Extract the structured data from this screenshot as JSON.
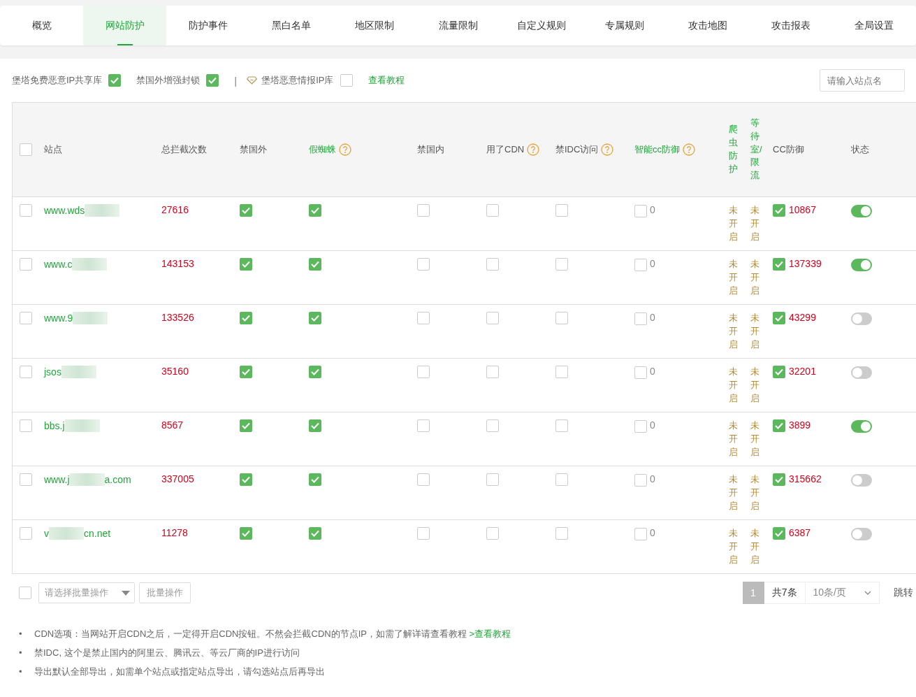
{
  "tabs": [
    {
      "label": "概览",
      "selected": false
    },
    {
      "label": "网站防护",
      "selected": true
    },
    {
      "label": "防护事件",
      "selected": false
    },
    {
      "label": "黑白名单",
      "selected": false
    },
    {
      "label": "地区限制",
      "selected": false
    },
    {
      "label": "流量限制",
      "selected": false
    },
    {
      "label": "自定义规则",
      "selected": false
    },
    {
      "label": "专属规则",
      "selected": false
    },
    {
      "label": "攻击地图",
      "selected": false
    },
    {
      "label": "攻击报表",
      "selected": false
    },
    {
      "label": "全局设置",
      "selected": false
    }
  ],
  "filters": [
    {
      "kind": "check",
      "label": "堡塔免费恶意IP共享库",
      "checked": true
    },
    {
      "kind": "check",
      "label": "禁国外增强封锁",
      "checked": true
    },
    {
      "kind": "separator",
      "label": "|"
    },
    {
      "kind": "premium",
      "label": "堡塔恶意情报IP库",
      "checked": false
    },
    {
      "kind": "link",
      "label": "查看教程"
    }
  ],
  "search": {
    "placeholder": "请输入站点名"
  },
  "table": {
    "header_checked": false,
    "columns": [
      {
        "label": "站点",
        "accent": false,
        "vertical": false
      },
      {
        "label": "总拦截次数",
        "accent": false,
        "vertical": false
      },
      {
        "label": "禁国外",
        "accent": false,
        "vertical": false
      },
      {
        "label": "假蜘蛛",
        "accent": true,
        "help": true,
        "vertical": false
      },
      {
        "label": "禁国内",
        "accent": false,
        "vertical": false
      },
      {
        "label": "用了CDN",
        "accent": false,
        "help": true,
        "vertical": false
      },
      {
        "label": "禁IDC访问",
        "accent": false,
        "help": true,
        "vertical": false
      },
      {
        "label": "智能cc防御",
        "accent": true,
        "help": true,
        "vertical": false
      },
      {
        "label": "爬虫防护",
        "accent": true,
        "vertical": true
      },
      {
        "label": "等待室/限流",
        "accent": true,
        "vertical": true
      },
      {
        "label": "CC防御",
        "accent": false,
        "vertical": false
      },
      {
        "label": "状态",
        "accent": false,
        "vertical": false
      }
    ],
    "rows": [
      {
        "selected": false,
        "site": "www.wds",
        "total": "27616",
        "ban_foreign": true,
        "fake_spider": true,
        "ban_domestic": false,
        "cdn": false,
        "idc": false,
        "smart_cc": false,
        "smart_cc_count": "0",
        "crawler": "未开启",
        "waiting_room": "未开启",
        "cc": true,
        "cc_count": "10867",
        "on": true
      },
      {
        "selected": false,
        "site": "www.c",
        "total": "143153",
        "ban_foreign": true,
        "fake_spider": true,
        "ban_domestic": false,
        "cdn": false,
        "idc": false,
        "smart_cc": false,
        "smart_cc_count": "0",
        "crawler": "未开启",
        "waiting_room": "未开启",
        "cc": true,
        "cc_count": "137339",
        "on": true
      },
      {
        "selected": false,
        "site": "www.9",
        "total": "133526",
        "ban_foreign": true,
        "fake_spider": true,
        "ban_domestic": false,
        "cdn": false,
        "idc": false,
        "smart_cc": false,
        "smart_cc_count": "0",
        "crawler": "未开启",
        "waiting_room": "未开启",
        "cc": true,
        "cc_count": "43299",
        "on": false
      },
      {
        "selected": false,
        "site": "jsos",
        "total": "35160",
        "ban_foreign": true,
        "fake_spider": true,
        "ban_domestic": false,
        "cdn": false,
        "idc": false,
        "smart_cc": false,
        "smart_cc_count": "0",
        "crawler": "未开启",
        "waiting_room": "未开启",
        "cc": true,
        "cc_count": "32201",
        "on": false
      },
      {
        "selected": false,
        "site": "bbs.j",
        "total": "8567",
        "ban_foreign": true,
        "fake_spider": true,
        "ban_domestic": false,
        "cdn": false,
        "idc": false,
        "smart_cc": false,
        "smart_cc_count": "0",
        "crawler": "未开启",
        "waiting_room": "未开启",
        "cc": true,
        "cc_count": "3899",
        "on": true
      },
      {
        "selected": false,
        "site": "www.j",
        "site_end": "a.com",
        "total": "337005",
        "ban_foreign": true,
        "fake_spider": true,
        "ban_domestic": false,
        "cdn": false,
        "idc": false,
        "smart_cc": false,
        "smart_cc_count": "0",
        "crawler": "未开启",
        "waiting_room": "未开启",
        "cc": true,
        "cc_count": "315662",
        "on": false
      },
      {
        "selected": false,
        "site": "v",
        "site_end": "cn.net",
        "total": "11278",
        "ban_foreign": true,
        "fake_spider": true,
        "ban_domestic": false,
        "cdn": false,
        "idc": false,
        "smart_cc": false,
        "smart_cc_count": "0",
        "crawler": "未开启",
        "waiting_room": "未开启",
        "cc": true,
        "cc_count": "6387",
        "on": false
      }
    ]
  },
  "batch": {
    "checked": false,
    "select_placeholder": "请选择批量操作",
    "button": "批量操作"
  },
  "pagination": {
    "pages": [
      {
        "label": "1",
        "selected": true
      }
    ],
    "total": "共7条",
    "page_size": "10条/页",
    "jump": "跳转"
  },
  "notes": [
    {
      "bullet": "•",
      "text": "CDN选项：当网站开启CDN之后，一定得开启CDN按钮。不然会拦截CDN的节点IP，如需了解详请查看教程 ",
      "link": ">查看教程"
    },
    {
      "bullet": "•",
      "text": "禁IDC, 这个是禁止国内的阿里云、腾讯云、等云厂商的IP进行访问"
    },
    {
      "bullet": "•",
      "text": "导出默认全部导出，如需单个站点或指定站点导出，请勾选站点后再导出"
    }
  ]
}
